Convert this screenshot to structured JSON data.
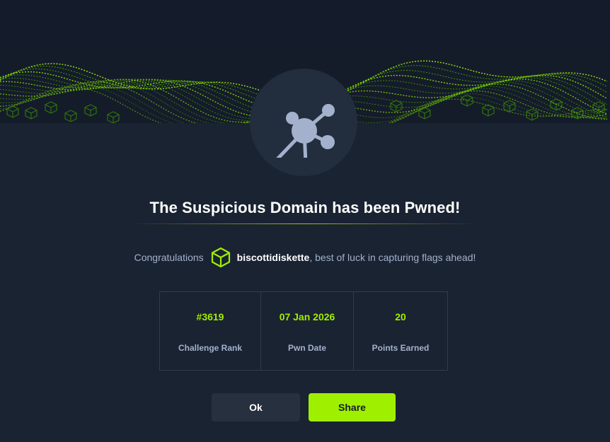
{
  "header": {
    "title": "The Suspicious Domain has been Pwned!",
    "badge_icon": "network-node-icon"
  },
  "congrats": {
    "prefix": "Congratulations",
    "username": "biscottidiskette",
    "suffix": ", best of luck in capturing flags ahead!",
    "user_icon": "cube-icon"
  },
  "stats": [
    {
      "value": "#3619",
      "label": "Challenge Rank"
    },
    {
      "value": "07 Jan 2026",
      "label": "Pwn Date"
    },
    {
      "value": "20",
      "label": "Points Earned"
    }
  ],
  "buttons": {
    "ok": "Ok",
    "share": "Share"
  },
  "colors": {
    "background": "#1a2332",
    "accent": "#9fef00",
    "muted_text": "#a4b1cd",
    "card_border": "#2f3b4d"
  }
}
